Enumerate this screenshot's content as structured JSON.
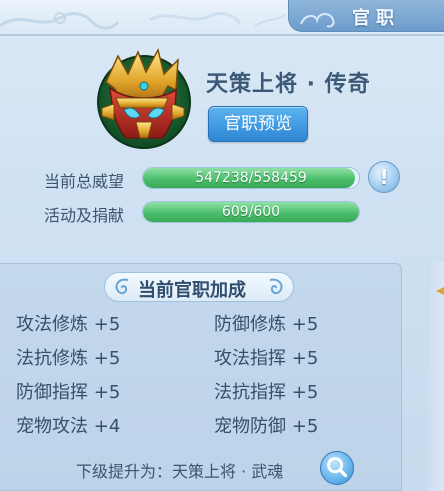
{
  "header": {
    "title": "官职"
  },
  "rank": {
    "title": "天策上将 · 传奇",
    "preview_button": "官职预览",
    "emblem_icon": "golden-general-helmet-icon"
  },
  "stats": [
    {
      "label": "当前总威望",
      "value_text": "547238/558459",
      "current": 547238,
      "max": 558459
    },
    {
      "label": "活动及捐献",
      "value_text": "609/600",
      "current": 609,
      "max": 600
    }
  ],
  "info_icon": "exclamation-info-icon",
  "bonus": {
    "header": "当前官职加成",
    "items": [
      {
        "name": "攻法修炼",
        "value": "+5"
      },
      {
        "name": "防御修炼",
        "value": "+5"
      },
      {
        "name": "法抗修炼",
        "value": "+5"
      },
      {
        "name": "攻法指挥",
        "value": "+5"
      },
      {
        "name": "防御指挥",
        "value": "+5"
      },
      {
        "name": "法抗指挥",
        "value": "+5"
      },
      {
        "name": "宠物攻法",
        "value": "+4"
      },
      {
        "name": "宠物防御",
        "value": "+5"
      }
    ]
  },
  "next_rank": {
    "text": "下级提升为：天策上将 · 武魂",
    "search_icon": "magnifier-icon"
  },
  "colors": {
    "accent_blue": "#2f86d4",
    "progress_green": "#4cbf6c",
    "text_dark": "#3a5670",
    "panel_bg": "#cfe1f2"
  }
}
